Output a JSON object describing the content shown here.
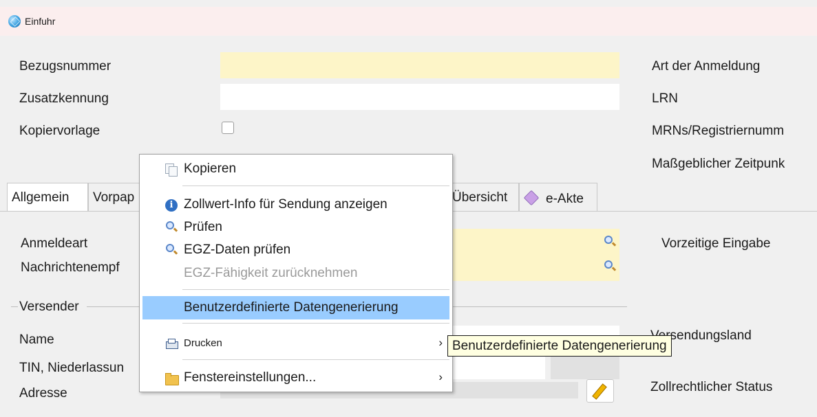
{
  "window": {
    "title": "Einfuhr",
    "icon": "app-cube-icon"
  },
  "form": {
    "bezugsnummer": "Bezugsnummer",
    "zusatzkennung": "Zusatzkennung",
    "kopiervorlage": "Kopiervorlage",
    "art_der_anmeldung": "Art der Anmeldung",
    "lrn": "LRN",
    "mrns": "MRNs/Registriernumm",
    "massgeblicher_zeitpunkt": "Maßgeblicher Zeitpunk"
  },
  "tabs": [
    {
      "label": "Allgemein",
      "active": true
    },
    {
      "label": "Vorpap"
    },
    {
      "label": "Übersicht"
    },
    {
      "label": "e-Akte",
      "icon": "tag-icon"
    }
  ],
  "panel": {
    "anmeldeart": "Anmeldeart",
    "nachrichtenempf": "Nachrichtenempf",
    "vorzeitige_eingabe": "Vorzeitige Eingabe",
    "versender_group": "Versender",
    "name": "Name",
    "tin": "TIN, Niederlassun",
    "adresse": "Adresse",
    "versendungsland": "Versendungsland",
    "zollrechtlicher_status": "Zollrechtlicher Status"
  },
  "context_menu": {
    "items": [
      {
        "label": "Kopieren",
        "icon": "copy-icon"
      },
      {
        "label": "Zollwert-Info für Sendung anzeigen",
        "icon": "info-icon"
      },
      {
        "label": "Prüfen",
        "icon": "magnifier-icon"
      },
      {
        "label": "EGZ-Daten prüfen",
        "icon": "magnifier-icon"
      },
      {
        "label": "EGZ-Fähigkeit zurücknehmen",
        "disabled": true
      },
      {
        "label": "Benutzerdefinierte Datengenerierung",
        "highlighted": true
      },
      {
        "label": "Drucken",
        "icon": "printer-icon",
        "submenu_arrow": "›"
      },
      {
        "label": "Fenstereinstellungen...",
        "icon": "folder-icon",
        "submenu_arrow": "›"
      }
    ]
  },
  "tooltip": {
    "text": "Benutzerdefinierte Datengenerierung"
  },
  "colors": {
    "required_field": "#fdf5c8",
    "highlight": "#99ccff",
    "tooltip_bg": "#ffffe1"
  }
}
